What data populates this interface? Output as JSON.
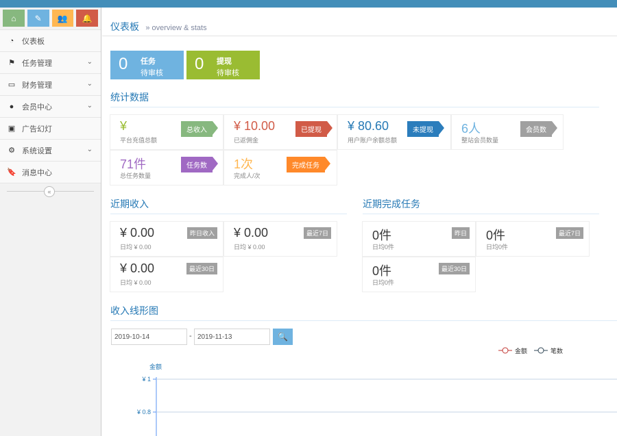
{
  "shortcuts": [
    {
      "name": "home",
      "glyph": "⌂"
    },
    {
      "name": "pencil",
      "glyph": "✎"
    },
    {
      "name": "users",
      "glyph": "👥"
    },
    {
      "name": "bell",
      "glyph": "🔔"
    }
  ],
  "sidebar": {
    "items": [
      {
        "label": "仪表板",
        "icon": "dashboard-icon",
        "glyph": "◔",
        "has_children": false
      },
      {
        "label": "任务管理",
        "icon": "flag-icon",
        "glyph": "⚑",
        "has_children": true
      },
      {
        "label": "财务管理",
        "icon": "hdd-icon",
        "glyph": "▭",
        "has_children": true
      },
      {
        "label": "会员中心",
        "icon": "user-icon",
        "glyph": "●",
        "has_children": true
      },
      {
        "label": "广告幻灯",
        "icon": "picture-icon",
        "glyph": "▣",
        "has_children": false
      },
      {
        "label": "系统设置",
        "icon": "cog-icon",
        "glyph": "⚙",
        "has_children": true
      },
      {
        "label": "消息中心",
        "icon": "bookmark-icon",
        "glyph": "🔖",
        "has_children": false
      }
    ],
    "chevron": "⌄",
    "collapse_glyph": "«"
  },
  "breadcrumb": {
    "title": "仪表板",
    "subtitle": "» overview & stats"
  },
  "infoboxes": [
    {
      "number": "0",
      "line1": "任务",
      "line2": "待审核",
      "color": "#6fb3e0"
    },
    {
      "number": "0",
      "line1": "提现",
      "line2": "待审核",
      "color": "#9abc32"
    }
  ],
  "stats_title": "统计数据",
  "stats": [
    {
      "value": "¥",
      "sub": "平台充值总额",
      "tag": "总收入",
      "value_color": "#9abc32",
      "tag_color": "#87b87f"
    },
    {
      "value": "¥ 10.00",
      "sub": "已返佣金",
      "tag": "已提现",
      "value_color": "#d15b47",
      "tag_color": "#d15b47"
    },
    {
      "value": "¥ 80.60",
      "sub": "用户账户余额总额",
      "tag": "未提现",
      "value_color": "#2679b5",
      "tag_color": "#2b7dbc"
    },
    {
      "value": "6人",
      "sub": "整站会员数量",
      "tag": "会员数",
      "value_color": "#6fb3e0",
      "tag_color": "#a0a0a0"
    },
    {
      "value": "71件",
      "sub": "总任务数量",
      "tag": "任务数",
      "value_color": "#a069c3",
      "tag_color": "#a069c3"
    },
    {
      "value": "1次",
      "sub": "完成人/次",
      "tag": "完成任务",
      "value_color": "#ffb752",
      "tag_color": "#ff892a"
    }
  ],
  "income_title": "近期收入",
  "income": [
    {
      "value": "¥ 0.00",
      "sub": "日均 ¥ 0.00",
      "flag": "昨日收入"
    },
    {
      "value": "¥ 0.00",
      "sub": "日均 ¥ 0.00",
      "flag": "最近7日"
    },
    {
      "value": "¥ 0.00",
      "sub": "日均 ¥ 0.00",
      "flag": "最近30日"
    }
  ],
  "tasks_title": "近期完成任务",
  "tasks": [
    {
      "value": "0件",
      "sub": "日均0件",
      "flag": "昨日"
    },
    {
      "value": "0件",
      "sub": "日均0件",
      "flag": "最近7日"
    },
    {
      "value": "0件",
      "sub": "日均0件",
      "flag": "最近30日"
    }
  ],
  "chart_section_title": "收入线形图",
  "date_from": "2019-10-14",
  "date_sep": "-",
  "date_to": "2019-11-13",
  "search_glyph": "🔍",
  "chart_data": {
    "type": "line",
    "ylabel": "金额",
    "y_ticks": [
      "¥ 1",
      "¥ 0.8"
    ],
    "series": [
      {
        "name": "金额",
        "color": "#c23531",
        "values": []
      },
      {
        "name": "笔数",
        "color": "#2f4554",
        "values": []
      }
    ]
  }
}
